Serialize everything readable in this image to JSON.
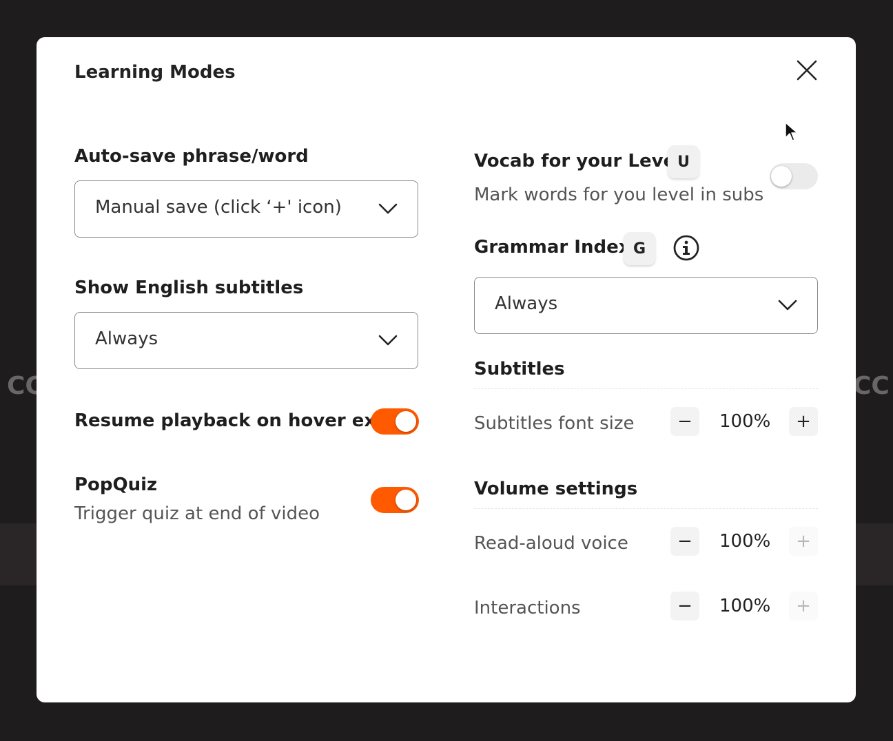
{
  "modal": {
    "title": "Learning Modes",
    "close_icon": "close-icon"
  },
  "left": {
    "autosave": {
      "label": "Auto-save phrase/word",
      "value": "Manual save (click ‘+' icon)"
    },
    "english_subs": {
      "label": "Show English subtitles",
      "value": "Always"
    },
    "resume": {
      "label": "Resume playback on hover exit",
      "on": true
    },
    "popquiz": {
      "label": "PopQuiz",
      "description": "Trigger quiz at end of video",
      "on": true
    }
  },
  "right": {
    "vocab": {
      "label": "Vocab for your Level",
      "key": "U",
      "description": "Mark words for you level in subs",
      "on": false
    },
    "grammar": {
      "label": "Grammar Index",
      "key": "G",
      "info_icon": "info-icon",
      "value": "Always"
    },
    "subtitles": {
      "heading": "Subtitles",
      "font_size": {
        "label": "Subtitles font size",
        "value": "100%",
        "minus": "−",
        "plus": "+"
      }
    },
    "volume": {
      "heading": "Volume settings",
      "read_aloud": {
        "label": "Read-aloud voice",
        "value": "100%",
        "minus": "−",
        "plus": "+"
      },
      "interactions": {
        "label": "Interactions",
        "value": "100%",
        "minus": "−",
        "plus": "+"
      }
    }
  },
  "background": {
    "left_ghost": "CC",
    "right_ghost": "CC"
  },
  "colors": {
    "accent": "#ff5a00",
    "toggle_off": "#ebebeb"
  }
}
